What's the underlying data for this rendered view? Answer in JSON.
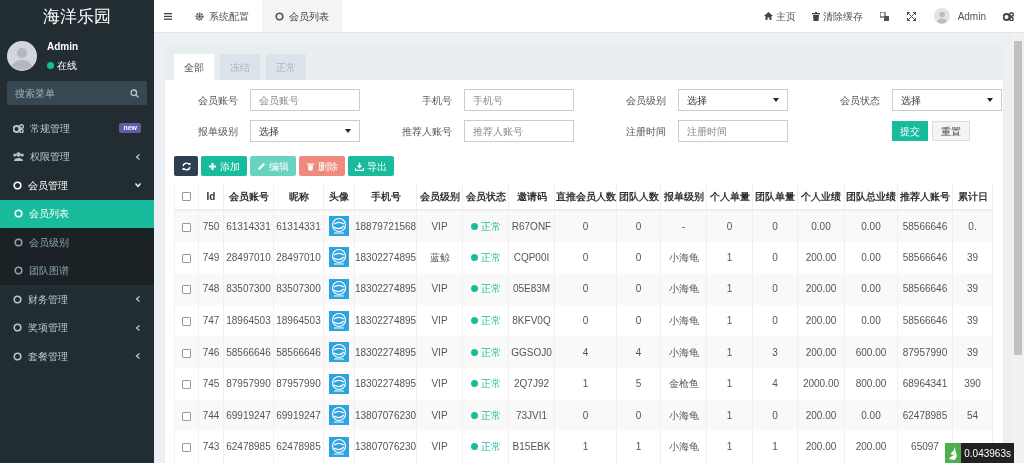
{
  "sidebar": {
    "logo": "海洋乐园",
    "user": {
      "name": "Admin",
      "status": "在线"
    },
    "search": {
      "placeholder": "搜索菜单"
    },
    "items": [
      {
        "label": "常规管理",
        "badge": "new",
        "selected": false
      },
      {
        "label": "权限管理",
        "caret": true,
        "expanded": false,
        "selected": false
      },
      {
        "label": "会员管理",
        "caret": true,
        "expanded": true,
        "selected": false,
        "children": [
          {
            "label": "会员列表",
            "selected": true
          },
          {
            "label": "会员级别",
            "selected": false
          },
          {
            "label": "团队图谱",
            "selected": false
          }
        ]
      },
      {
        "label": "财务管理",
        "caret": true,
        "expanded": false,
        "selected": false
      },
      {
        "label": "奖项管理",
        "caret": true,
        "expanded": false,
        "selected": false
      },
      {
        "label": "套餐管理",
        "caret": true,
        "expanded": false,
        "selected": false
      }
    ]
  },
  "topbar": {
    "tabs": [
      {
        "label": "系统配置",
        "selected": false
      },
      {
        "label": "会员列表",
        "selected": true
      }
    ],
    "links": [
      {
        "label": "主页"
      },
      {
        "label": "清除缓存"
      }
    ],
    "user": "Admin"
  },
  "panel": {
    "tabs": [
      {
        "label": "全部",
        "selected": true
      },
      {
        "label": "冻结",
        "selected": false
      },
      {
        "label": "正常",
        "selected": false
      }
    ],
    "filters": [
      {
        "label": "会员账号",
        "kind": "input",
        "placeholder": "会员账号"
      },
      {
        "label": "手机号",
        "kind": "input",
        "placeholder": "手机号"
      },
      {
        "label": "会员级别",
        "kind": "select",
        "value": "选择"
      },
      {
        "label": "会员状态",
        "kind": "select",
        "value": "选择"
      },
      {
        "label": "报单级别",
        "kind": "select",
        "value": "选择"
      },
      {
        "label": "推荐人账号",
        "kind": "input",
        "placeholder": "推荐人账号"
      },
      {
        "label": "注册时间",
        "kind": "input",
        "placeholder": "注册时间"
      }
    ],
    "filter_buttons": [
      {
        "label": "提交",
        "kind": "primary"
      },
      {
        "label": "重置",
        "kind": "default"
      }
    ],
    "toolbar": [
      {
        "kind": "refresh",
        "disabled": false
      },
      {
        "kind": "add",
        "label": "添加",
        "disabled": false
      },
      {
        "kind": "edit",
        "label": "编辑",
        "disabled": true
      },
      {
        "kind": "delete",
        "label": "删除",
        "disabled": true
      },
      {
        "kind": "export",
        "label": "导出",
        "disabled": false
      }
    ],
    "table": {
      "select_all_checked": false,
      "columns": [
        {
          "kind": "text",
          "label": "Id"
        },
        {
          "kind": "text",
          "label": "会员账号"
        },
        {
          "kind": "text",
          "label": "昵称"
        },
        {
          "kind": "avatar",
          "label": "头像"
        },
        {
          "kind": "text",
          "label": "手机号"
        },
        {
          "kind": "text",
          "label": "会员级别"
        },
        {
          "kind": "status",
          "label": "会员状态"
        },
        {
          "kind": "text",
          "label": "邀请码"
        },
        {
          "kind": "text",
          "label": "直推会员人数"
        },
        {
          "kind": "text",
          "label": "团队人数"
        },
        {
          "kind": "text",
          "label": "报单级别"
        },
        {
          "kind": "text",
          "label": "个人单量"
        },
        {
          "kind": "text",
          "label": "团队单量"
        },
        {
          "kind": "text",
          "label": "个人业绩"
        },
        {
          "kind": "text",
          "label": "团队总业绩"
        },
        {
          "kind": "text",
          "label": "推荐人账号"
        },
        {
          "kind": "text",
          "label": "累计日"
        }
      ],
      "rows": [
        {
          "checked": false,
          "cells": [
            "750",
            "61314331",
            "61314331",
            "",
            "18879721568",
            "VIP",
            "正常",
            "R67ONF",
            "0",
            "0",
            "-",
            "0",
            "0",
            "0.00",
            "0.00",
            "58566646",
            "0."
          ]
        },
        {
          "checked": false,
          "cells": [
            "749",
            "28497010",
            "28497010",
            "",
            "18302274895",
            "蓝鲸",
            "正常",
            "CQP00I",
            "0",
            "0",
            "小海龟",
            "1",
            "0",
            "200.00",
            "0.00",
            "58566646",
            "39"
          ]
        },
        {
          "checked": false,
          "cells": [
            "748",
            "83507300",
            "83507300",
            "",
            "18302274895",
            "VIP",
            "正常",
            "05E83M",
            "0",
            "0",
            "小海龟",
            "1",
            "0",
            "200.00",
            "0.00",
            "58566646",
            "39"
          ]
        },
        {
          "checked": false,
          "cells": [
            "747",
            "18964503",
            "18964503",
            "",
            "18302274895",
            "VIP",
            "正常",
            "8KFV0Q",
            "0",
            "0",
            "小海龟",
            "1",
            "0",
            "200.00",
            "0.00",
            "58566646",
            "39"
          ]
        },
        {
          "checked": false,
          "cells": [
            "746",
            "58566646",
            "58566646",
            "",
            "18302274895",
            "VIP",
            "正常",
            "GGSOJ0",
            "4",
            "4",
            "小海龟",
            "1",
            "3",
            "200.00",
            "600.00",
            "87957990",
            "39"
          ]
        },
        {
          "checked": false,
          "cells": [
            "745",
            "87957990",
            "87957990",
            "",
            "18302274895",
            "VIP",
            "正常",
            "2Q7J92",
            "1",
            "5",
            "金枪鱼",
            "1",
            "4",
            "2000.00",
            "800.00",
            "68964341",
            "390"
          ]
        },
        {
          "checked": false,
          "cells": [
            "744",
            "69919247",
            "69919247",
            "",
            "13807076230",
            "VIP",
            "正常",
            "73JVI1",
            "0",
            "0",
            "小海龟",
            "1",
            "0",
            "200.00",
            "0.00",
            "62478985",
            "54"
          ]
        },
        {
          "checked": false,
          "cells": [
            "743",
            "62478985",
            "62478985",
            "",
            "13807076230",
            "VIP",
            "正常",
            "B15EBK",
            "1",
            "1",
            "小海龟",
            "1",
            "1",
            "200.00",
            "200.00",
            "65097"
          ]
        }
      ]
    }
  },
  "trace": "0.043963s"
}
